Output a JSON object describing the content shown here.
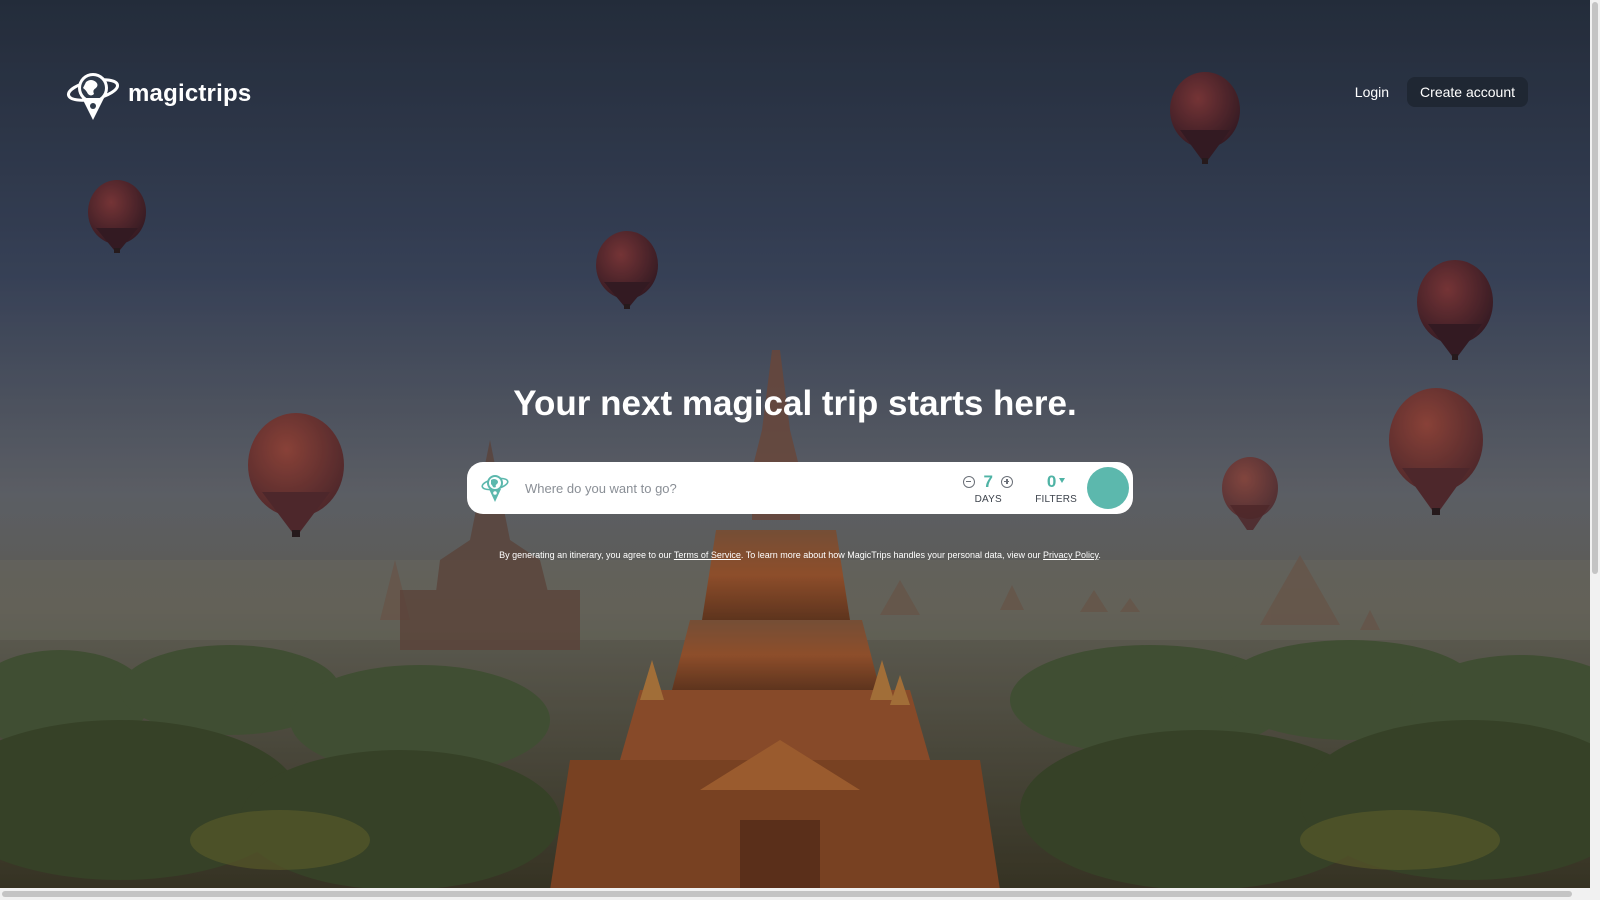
{
  "header": {
    "brand": "magictrips",
    "login_label": "Login",
    "create_account_label": "Create account"
  },
  "hero": {
    "title": "Your next magical trip starts here."
  },
  "search": {
    "placeholder": "Where do you want to go?",
    "value": "",
    "days_value": "7",
    "days_label": "DAYS",
    "filters_value": "0",
    "filters_label": "FILTERS",
    "pin_icon": "map-pin-globe-icon",
    "minus_icon": "minus-circle-icon",
    "plus_icon": "plus-circle-icon",
    "filter_icon": "filter-funnel-icon"
  },
  "disclaimer": {
    "text_before": "By generating an itinerary, you agree to our ",
    "terms_link": "Terms of Service",
    "text_middle": ". To learn more about how MagicTrips handles your personal data, view our ",
    "privacy_link": "Privacy Policy",
    "text_after": "."
  },
  "colors": {
    "accent": "#5cb8ad",
    "accent_text": "#4fb3a5",
    "button_dark": "#1f2733",
    "text_white": "#ffffff"
  }
}
